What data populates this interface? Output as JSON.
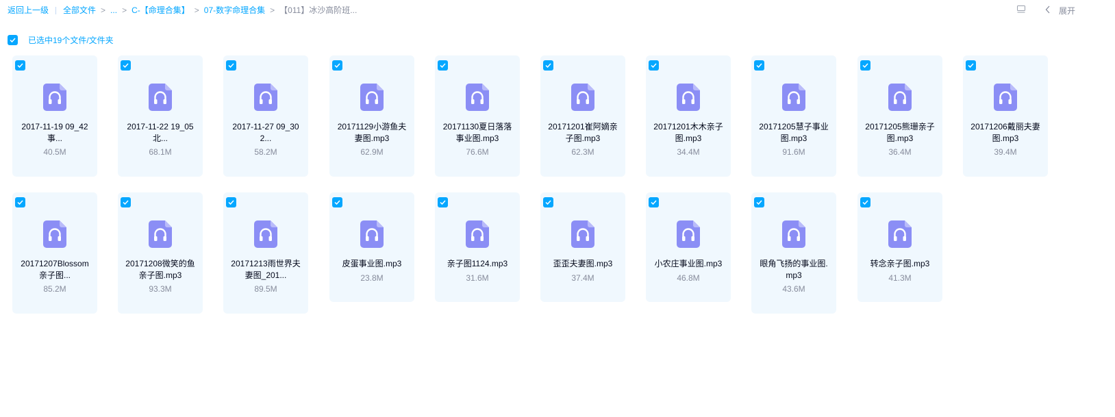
{
  "breadcrumb": {
    "back": "返回上一级",
    "all_files": "全部文件",
    "ellipsis": "...",
    "folder1": "C-【命理合集】",
    "folder2": "07-数字命理合集",
    "current": "【011】冰沙高阶班...",
    "separator": ">"
  },
  "toolbar": {
    "expand_label": "展开",
    "list_icon": "list-view-icon",
    "chevron_icon": "chevron-left-icon"
  },
  "selection": {
    "label": "已选中19个文件/文件夹",
    "checked": true
  },
  "colors": {
    "accent": "#06a7ff",
    "card_bg": "#f0f8fe",
    "icon_purple": "#8b8ef5",
    "muted_text": "#878c9c"
  },
  "files": [
    {
      "name_line1": "2017-11-19 09_42",
      "name_line2": "事...",
      "size": "40.5M",
      "icon": "audio-file-icon"
    },
    {
      "name_line1": "2017-11-22 19_05",
      "name_line2": "北...",
      "size": "68.1M",
      "icon": "audio-file-icon"
    },
    {
      "name_line1": "2017-11-27 09_30",
      "name_line2": "2...",
      "size": "58.2M",
      "icon": "audio-file-icon"
    },
    {
      "name_line1": "20171129小游鱼夫",
      "name_line2": "妻图.mp3",
      "size": "62.9M",
      "icon": "audio-file-icon"
    },
    {
      "name_line1": "20171130夏日落落",
      "name_line2": "事业图.mp3",
      "size": "76.6M",
      "icon": "audio-file-icon"
    },
    {
      "name_line1": "20171201崔阿嫡亲",
      "name_line2": "子图.mp3",
      "size": "62.3M",
      "icon": "audio-file-icon"
    },
    {
      "name_line1": "20171201木木亲子",
      "name_line2": "图.mp3",
      "size": "34.4M",
      "icon": "audio-file-icon"
    },
    {
      "name_line1": "20171205慧子事业",
      "name_line2": "图.mp3",
      "size": "91.6M",
      "icon": "audio-file-icon"
    },
    {
      "name_line1": "20171205熊珊亲子",
      "name_line2": "图.mp3",
      "size": "36.4M",
      "icon": "audio-file-icon"
    },
    {
      "name_line1": "20171206戴丽夫妻",
      "name_line2": "图.mp3",
      "size": "39.4M",
      "icon": "audio-file-icon"
    },
    {
      "name_line1": "20171207Blossom",
      "name_line2": "亲子图...",
      "size": "85.2M",
      "icon": "audio-file-icon"
    },
    {
      "name_line1": "20171208微笑的鱼",
      "name_line2": "亲子图.mp3",
      "size": "93.3M",
      "icon": "audio-file-icon"
    },
    {
      "name_line1": "20171213雨世界夫",
      "name_line2": "妻图_201...",
      "size": "89.5M",
      "icon": "audio-file-icon"
    },
    {
      "name_line1": "皮蛋事业图.mp3",
      "name_line2": "",
      "size": "23.8M",
      "icon": "audio-file-icon"
    },
    {
      "name_line1": "亲子图1124.mp3",
      "name_line2": "",
      "size": "31.6M",
      "icon": "audio-file-icon"
    },
    {
      "name_line1": "歪歪夫妻图.mp3",
      "name_line2": "",
      "size": "37.4M",
      "icon": "audio-file-icon"
    },
    {
      "name_line1": "小农庄事业图.mp3",
      "name_line2": "",
      "size": "46.8M",
      "icon": "audio-file-icon"
    },
    {
      "name_line1": "眼角飞扬的事业图.",
      "name_line2": "mp3",
      "size": "43.6M",
      "icon": "audio-file-icon"
    },
    {
      "name_line1": "转念亲子图.mp3",
      "name_line2": "",
      "size": "41.3M",
      "icon": "audio-file-icon"
    }
  ]
}
